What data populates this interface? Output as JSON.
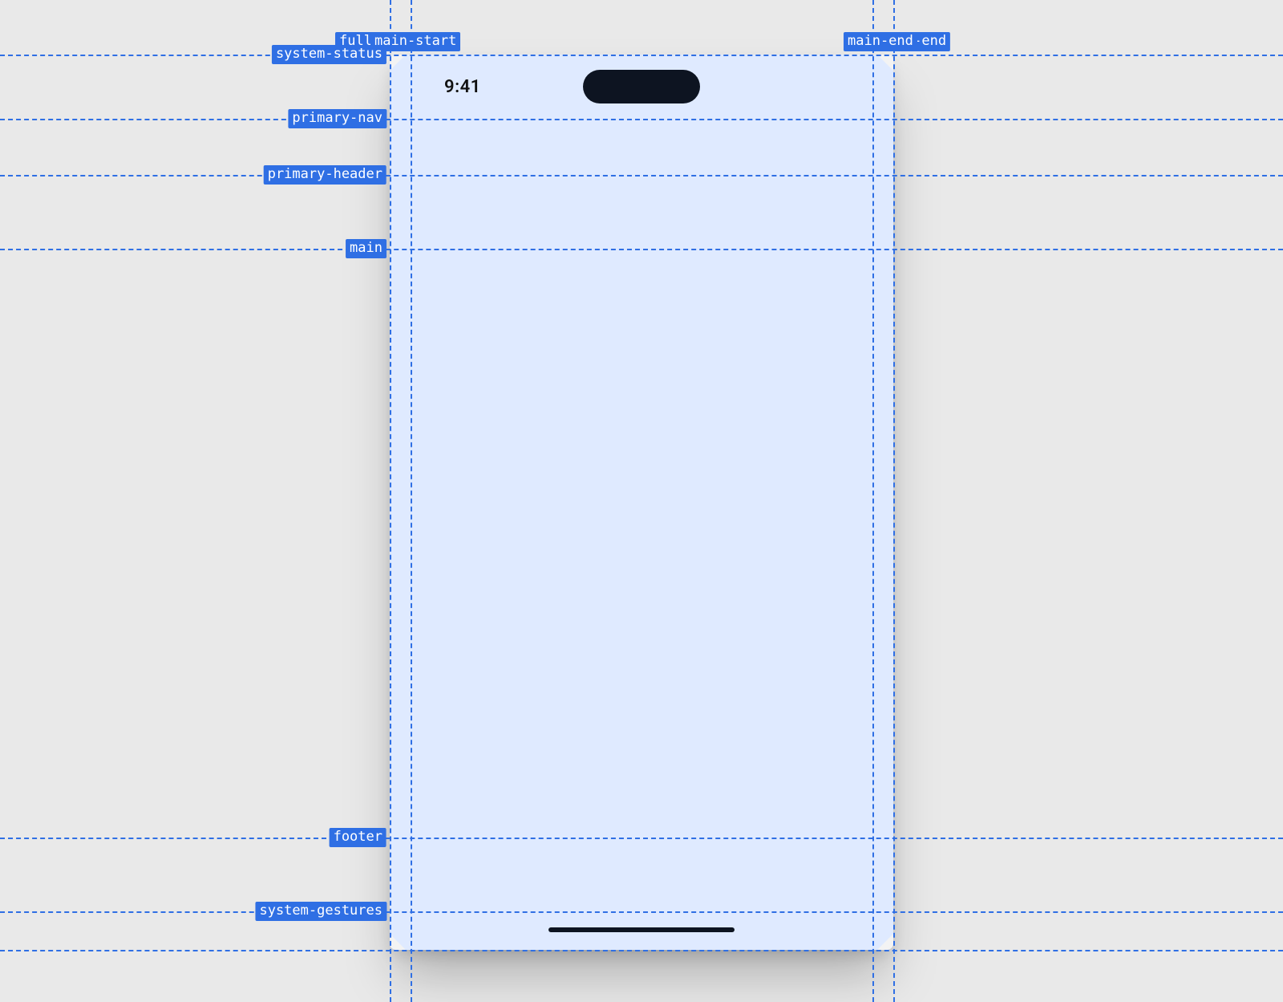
{
  "status_bar": {
    "time": "9:41"
  },
  "guides": {
    "horizontal": {
      "system_status": "system-status",
      "primary_nav": "primary-nav",
      "primary_header": "primary-header",
      "main": "main",
      "footer": "footer",
      "system_gestures": "system-gestures"
    },
    "vertical": {
      "full_bleed": "fullb",
      "main_start": "main-start",
      "main_end": "main-end",
      "full_end": "d-end"
    }
  },
  "colors": {
    "guide": "#2f6fe4",
    "device_bg": "#dfeaff",
    "page_bg": "#e9e9e9",
    "ink": "#0d1421"
  }
}
